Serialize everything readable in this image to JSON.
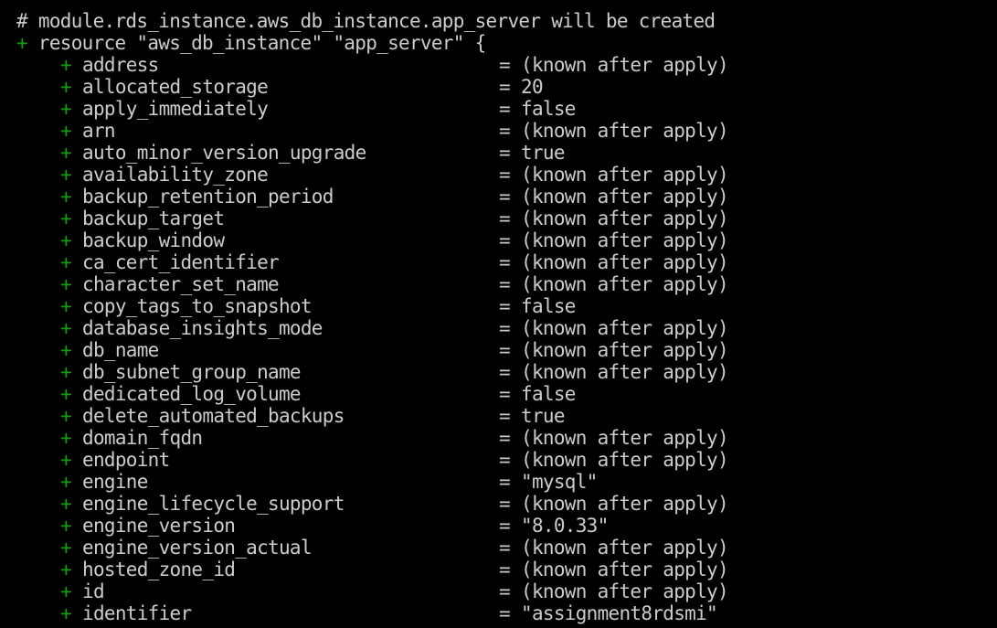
{
  "terminal": {
    "header_comment": "# module.rds_instance.aws_db_instance.app_server will be created",
    "resource_plus": "+",
    "resource_line": "resource \"aws_db_instance\" \"app_server\" {",
    "attr_plus": "+",
    "equals": "=",
    "attributes": [
      {
        "key": "address",
        "value": "(known after apply)"
      },
      {
        "key": "allocated_storage",
        "value": "20"
      },
      {
        "key": "apply_immediately",
        "value": "false"
      },
      {
        "key": "arn",
        "value": "(known after apply)"
      },
      {
        "key": "auto_minor_version_upgrade",
        "value": "true"
      },
      {
        "key": "availability_zone",
        "value": "(known after apply)"
      },
      {
        "key": "backup_retention_period",
        "value": "(known after apply)"
      },
      {
        "key": "backup_target",
        "value": "(known after apply)"
      },
      {
        "key": "backup_window",
        "value": "(known after apply)"
      },
      {
        "key": "ca_cert_identifier",
        "value": "(known after apply)"
      },
      {
        "key": "character_set_name",
        "value": "(known after apply)"
      },
      {
        "key": "copy_tags_to_snapshot",
        "value": "false"
      },
      {
        "key": "database_insights_mode",
        "value": "(known after apply)"
      },
      {
        "key": "db_name",
        "value": "(known after apply)"
      },
      {
        "key": "db_subnet_group_name",
        "value": "(known after apply)"
      },
      {
        "key": "dedicated_log_volume",
        "value": "false"
      },
      {
        "key": "delete_automated_backups",
        "value": "true"
      },
      {
        "key": "domain_fqdn",
        "value": "(known after apply)"
      },
      {
        "key": "endpoint",
        "value": "(known after apply)"
      },
      {
        "key": "engine",
        "value": "\"mysql\""
      },
      {
        "key": "engine_lifecycle_support",
        "value": "(known after apply)"
      },
      {
        "key": "engine_version",
        "value": "\"8.0.33\""
      },
      {
        "key": "engine_version_actual",
        "value": "(known after apply)"
      },
      {
        "key": "hosted_zone_id",
        "value": "(known after apply)"
      },
      {
        "key": "id",
        "value": "(known after apply)"
      },
      {
        "key": "identifier",
        "value": "\"assignment8rdsmi\""
      }
    ]
  },
  "colors": {
    "background": "#000000",
    "text": "#cccccc",
    "plus": "#13a10e"
  }
}
